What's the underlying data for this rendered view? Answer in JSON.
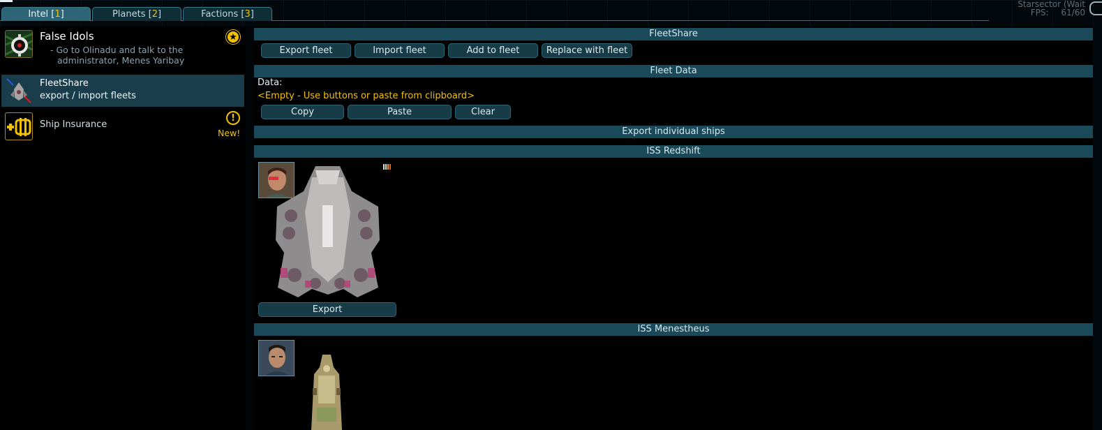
{
  "tabs": [
    {
      "label": "Intel [",
      "count": "1",
      "close": "]",
      "active": true
    },
    {
      "label": "Planets [",
      "count": "2",
      "close": "]",
      "active": false
    },
    {
      "label": "Factions [",
      "count": "3",
      "close": "]",
      "active": false
    }
  ],
  "overlay": {
    "line1": "Starsector (Wait",
    "fps_label": "FPS:",
    "fps_value": "61/60"
  },
  "intel_list": {
    "items": [
      {
        "title": "False Idols",
        "desc1": "- Go to Olinadu and talk to the",
        "desc2": "administrator, Menes Yaribay",
        "badge": "star",
        "icon": "target-icon"
      },
      {
        "title": "FleetShare",
        "sub": "export / import fleets",
        "selected": true,
        "icon": "ship-icon"
      },
      {
        "title": "Ship Insurance",
        "badge": "!",
        "new_label": "New!",
        "icon": "insurance-icon"
      }
    ]
  },
  "fleetshare": {
    "header": "FleetShare",
    "buttons": {
      "export": "Export fleet",
      "import": "Import fleet",
      "add": "Add to fleet",
      "replace": "Replace with fleet"
    },
    "data_header": "Fleet Data",
    "data_label": "Data:",
    "data_placeholder": "<Empty - Use buttons or paste from clipboard>",
    "data_buttons": {
      "copy": "Copy",
      "paste": "Paste",
      "clear": "Clear"
    },
    "individual_header": "Export individual ships",
    "ships": [
      {
        "name": "ISS Redshift",
        "export_label": "Export"
      },
      {
        "name": "ISS Menestheus"
      }
    ]
  },
  "colors": {
    "accent": "#f2c200",
    "header_bar": "#1a4a5a",
    "button": "#173c48",
    "selected_row": "#193d4a"
  }
}
